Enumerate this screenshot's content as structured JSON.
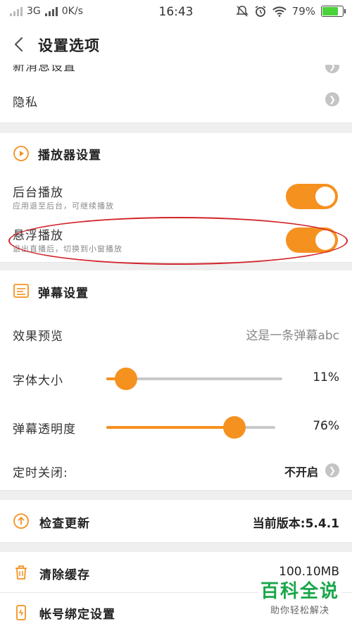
{
  "status_bar": {
    "network": "3G",
    "speed": "0K/s",
    "time": "16:43",
    "battery": "79%",
    "battery_level": 0.79
  },
  "header": {
    "title": "设置选项"
  },
  "rows": {
    "partial_top": {
      "label": "新消息设置"
    },
    "privacy": {
      "label": "隐私"
    },
    "player_section": {
      "label": "播放器设置"
    },
    "background_play": {
      "label": "后台播放",
      "desc": "应用退至后台，可继续播放",
      "on": true
    },
    "float_play": {
      "label": "悬浮播放",
      "desc": "退出直播后，切换到小窗播放",
      "on": true
    },
    "danmaku_section": {
      "label": "弹幕设置"
    },
    "effect_preview": {
      "label": "效果预览",
      "value": "这是一条弹幕abc"
    },
    "font_size": {
      "label": "字体大小",
      "value": "11%",
      "level": 0.11
    },
    "opacity": {
      "label": "弹幕透明度",
      "value": "76%",
      "level": 0.76
    },
    "timer_off": {
      "label": "定时关闭:",
      "value": "不开启"
    },
    "check_update": {
      "label": "检查更新",
      "value": "当前版本:5.4.1"
    },
    "clear_cache": {
      "label": "清除缓存",
      "value": "100.10MB"
    },
    "account_binding": {
      "label": "帐号绑定设置"
    }
  },
  "watermark": {
    "main": "百科全说",
    "sub": "助你轻松解决"
  },
  "colors": {
    "accent": "#f5911f",
    "annotation": "#d2232a",
    "watermark": "#1aa64a"
  }
}
